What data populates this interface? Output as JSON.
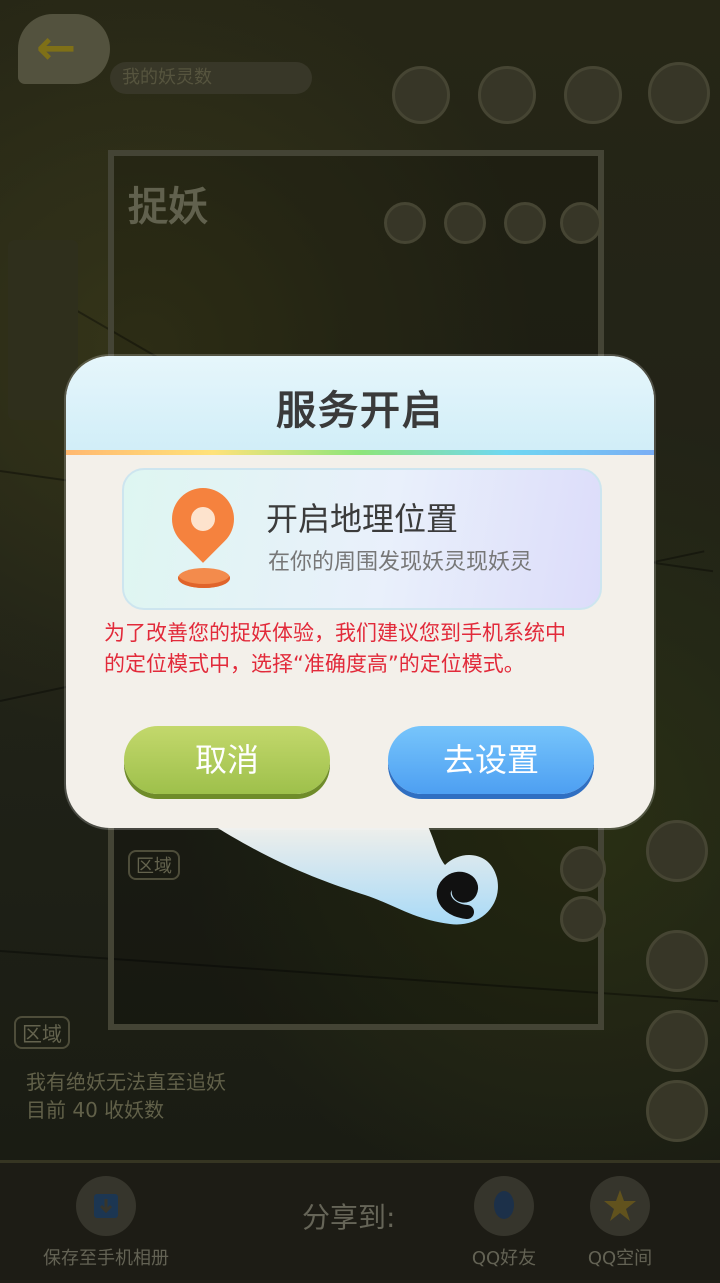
{
  "background": {
    "header_text": "我的妖灵数",
    "logo_text": "捉妖",
    "region_label": "区域",
    "bottom_line_1": "我有绝妖无法直至追妖",
    "bottom_line_2": "目前 40 收妖数"
  },
  "dialog": {
    "title": "服务开启",
    "location_card": {
      "title": "开启地理位置",
      "subtitle": "在你的周围发现妖灵现妖灵"
    },
    "notice_line_1": "为了改善您的捉妖体验，我们建议您到手机系统中",
    "notice_line_2": "的定位模式中，选择“准确度高”的定位模式。",
    "cancel_label": "取消",
    "settings_label": "去设置"
  },
  "share_bar": {
    "save_label": "保存至手机相册",
    "share_to_label": "分享到:",
    "qq_friends_label": "QQ好友",
    "qzone_label": "QQ空间"
  },
  "colors": {
    "cancel_button": "#a9c853",
    "settings_button": "#5aaaf5",
    "notice_text": "#e22a3a",
    "pin": "#f5823e"
  }
}
